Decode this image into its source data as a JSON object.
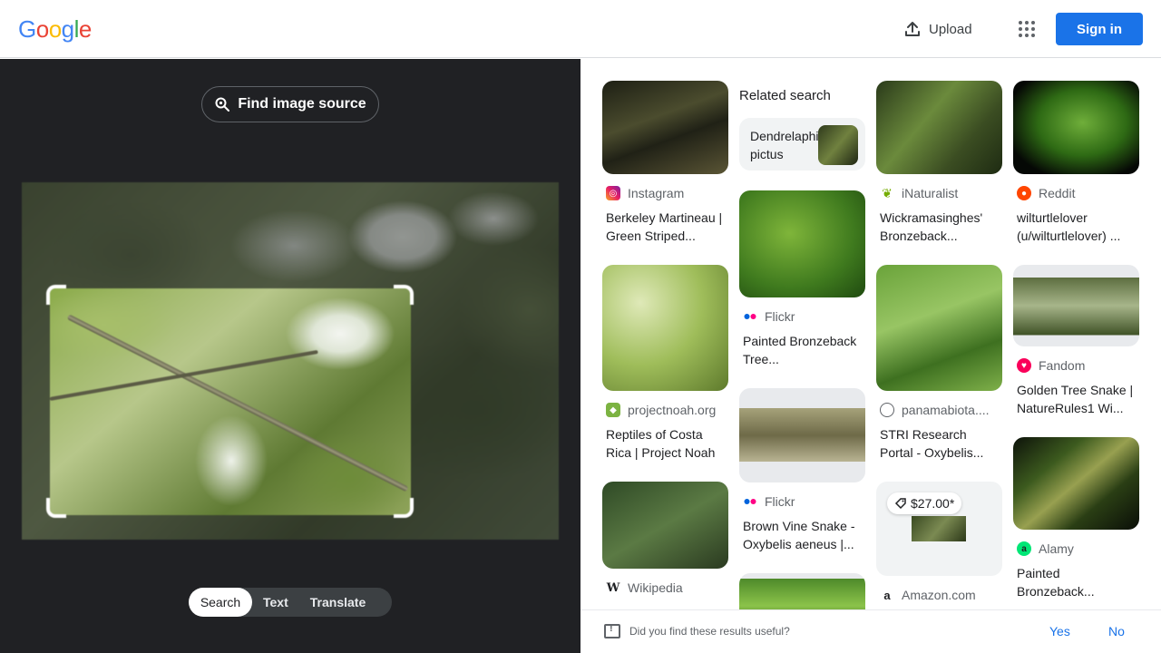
{
  "header": {
    "logo_letters": [
      "G",
      "o",
      "o",
      "g",
      "l",
      "e"
    ],
    "logo_colors": [
      "#4285f4",
      "#ea4335",
      "#fbbc05",
      "#4285f4",
      "#34a853",
      "#ea4335"
    ],
    "upload_label": "Upload",
    "signin_label": "Sign in"
  },
  "left": {
    "find_source_label": "Find image source",
    "tabs": [
      "Search",
      "Text",
      "Translate"
    ],
    "active_tab": "Search"
  },
  "results": {
    "related_heading": "Related search",
    "related_query": "Dendrelaphis pictus",
    "cards": [
      {
        "source": "Instagram",
        "title": "Berkeley Martineau | Green Striped..."
      },
      {
        "source": "projectnoah.org",
        "title": "Reptiles of Costa Rica | Project Noah"
      },
      {
        "source": "Wikipedia",
        "title": ""
      },
      {
        "source": "Flickr",
        "title": "Painted Bronzeback Tree..."
      },
      {
        "source": "Flickr",
        "title": "Brown Vine Snake - Oxybelis aeneus |..."
      },
      {
        "source": "iNaturalist",
        "title": "Wickramasinghes' Bronzeback..."
      },
      {
        "source": "panamabiota....",
        "title": "STRI Research Portal - Oxybelis..."
      },
      {
        "source": "Amazon.com",
        "title": "",
        "price": "$27.00*"
      },
      {
        "source": "Reddit",
        "title": "wilturtlelover (u/wilturtlelover) ..."
      },
      {
        "source": "Fandom",
        "title": "Golden Tree Snake | NatureRules1 Wi..."
      },
      {
        "source": "Alamy",
        "title": "Painted Bronzeback..."
      }
    ]
  },
  "feedback": {
    "question": "Did you find these results useful?",
    "yes": "Yes",
    "no": "No"
  },
  "colors": {
    "accent": "#1a73e8",
    "left_bg": "#202124"
  }
}
